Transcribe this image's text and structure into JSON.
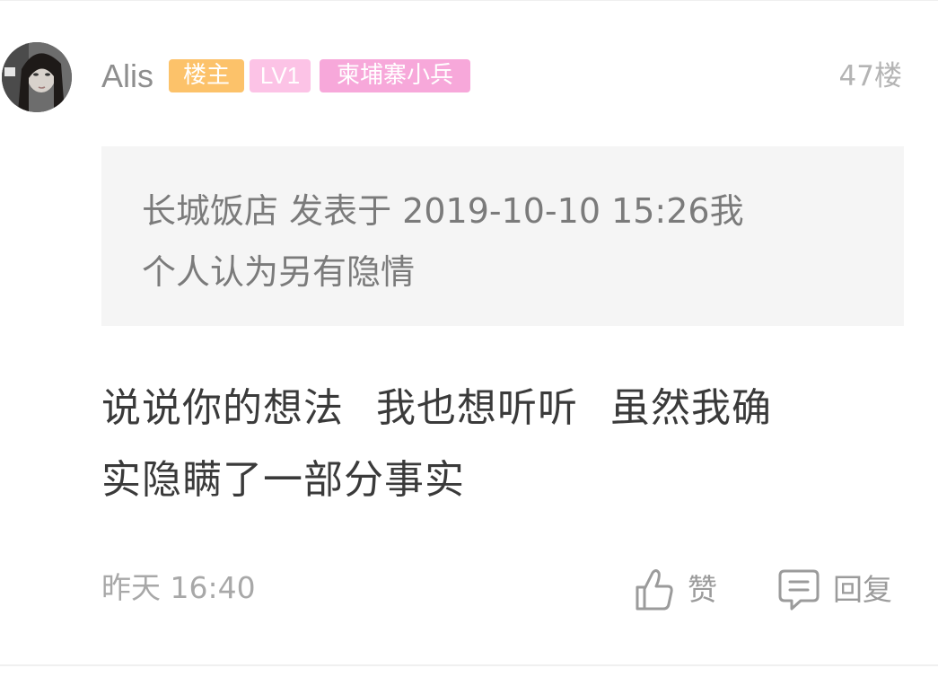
{
  "post": {
    "author": {
      "name": "Alis",
      "badges": {
        "owner": "楼主",
        "level": "LV1",
        "title": "柬埔寨小兵"
      }
    },
    "floor": "47楼",
    "quote": {
      "line1": "长城饭店 发表于 2019-10-10 15:26我",
      "line2": "个人认为另有隐情"
    },
    "content": {
      "part1": "说说你的想法",
      "part2": "我也想听听",
      "part3": "虽然我确",
      "line2": "实隐瞒了一部分事实"
    },
    "time": "昨天 16:40",
    "actions": {
      "like_label": "赞",
      "reply_label": "回复"
    }
  },
  "icons": {
    "like": "thumbs-up-icon",
    "reply": "comment-bubble-icon"
  }
}
